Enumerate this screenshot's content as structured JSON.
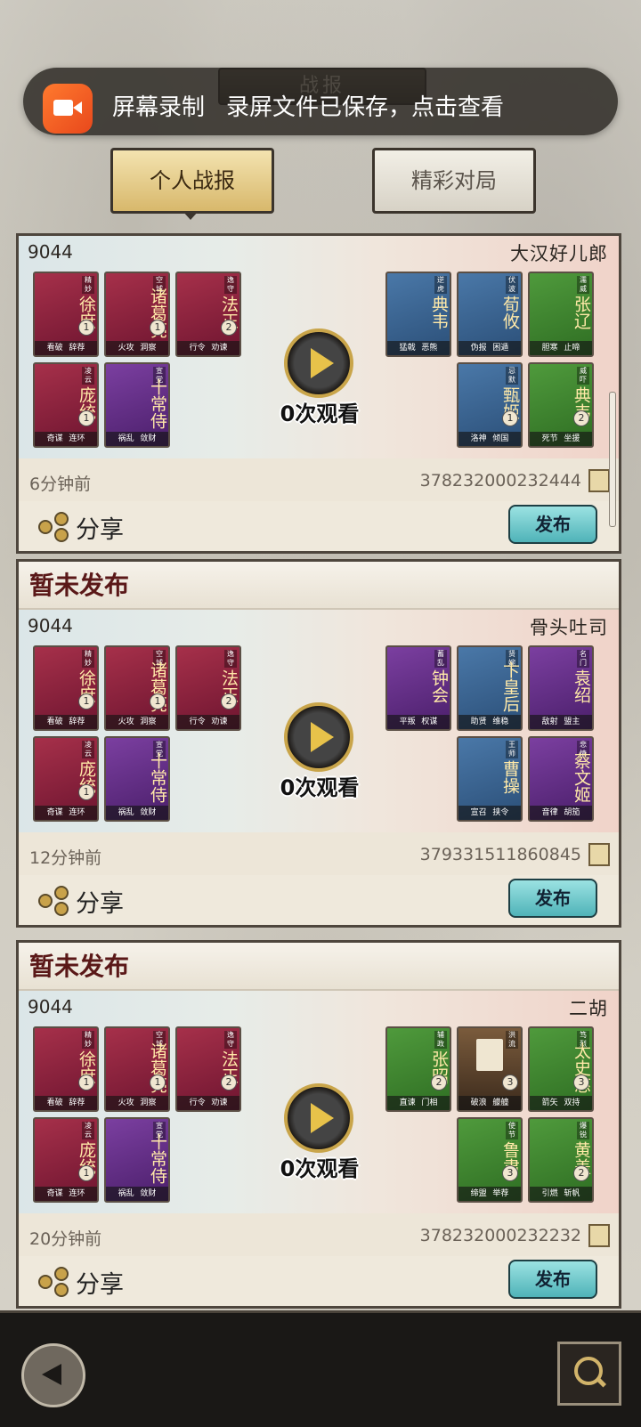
{
  "header": {
    "title": "战报"
  },
  "notification": {
    "app": "屏幕录制",
    "message": "录屏文件已保存，点击查看"
  },
  "tabs": [
    {
      "label": "个人战报",
      "active": true
    },
    {
      "label": "精彩对局",
      "active": false
    }
  ],
  "battles": [
    {
      "status": "",
      "score": "9044",
      "opponent": "大汉好儿郎",
      "views": "0次观看",
      "time": "6分钟前",
      "record_id": "378232000232444",
      "share_label": "分享",
      "publish_label": "发布",
      "left_heroes": [
        {
          "name": "徐庶",
          "tag": "精妙",
          "level": "1",
          "skills": "看破 辞荐",
          "color": "red"
        },
        {
          "name": "诸葛亮",
          "tag": "空城",
          "level": "1",
          "skills": "火攻 洞察",
          "color": "red"
        },
        {
          "name": "法正",
          "tag": "逸守",
          "level": "2",
          "skills": "行令 劝谏",
          "color": "red"
        },
        {
          "name": "庞统",
          "tag": "凌云",
          "level": "1",
          "skills": "奇谋 连环",
          "color": "red"
        },
        {
          "name": "十常侍",
          "tag": "宣党",
          "level": "",
          "skills": "祸乱 敛财",
          "color": "purple"
        }
      ],
      "right_heroes": [
        {
          "name": "典韦",
          "tag": "逆虎",
          "level": "",
          "skills": "猛戟 恶熊",
          "color": "blue"
        },
        {
          "name": "荀攸",
          "tag": "伏波",
          "level": "",
          "skills": "伪报 困遁",
          "color": "blue"
        },
        {
          "name": "张辽",
          "tag": "濡威",
          "level": "",
          "skills": "胆寒 止啼",
          "color": "green"
        },
        {
          "name": "甄姬",
          "tag": "忌默",
          "level": "1",
          "skills": "洛神 倾国",
          "color": "blue"
        },
        {
          "name": "典韦",
          "tag": "威吓",
          "level": "2",
          "skills": "死节 坐援",
          "color": "green"
        }
      ]
    },
    {
      "status": "暂未发布",
      "score": "9044",
      "opponent": "骨头吐司",
      "views": "0次观看",
      "time": "12分钟前",
      "record_id": "379331511860845",
      "share_label": "分享",
      "publish_label": "发布",
      "left_heroes": [
        {
          "name": "徐庶",
          "tag": "精妙",
          "level": "1",
          "skills": "看破 辞荐",
          "color": "red"
        },
        {
          "name": "诸葛亮",
          "tag": "空城",
          "level": "1",
          "skills": "火攻 洞察",
          "color": "red"
        },
        {
          "name": "法正",
          "tag": "逸守",
          "level": "2",
          "skills": "行令 劝谏",
          "color": "red"
        },
        {
          "name": "庞统",
          "tag": "凌云",
          "level": "1",
          "skills": "奇谋 连环",
          "color": "red"
        },
        {
          "name": "十常侍",
          "tag": "宣党",
          "level": "",
          "skills": "祸乱 敛财",
          "color": "purple"
        }
      ],
      "right_heroes": [
        {
          "name": "钟会",
          "tag": "蓄乱",
          "level": "",
          "skills": "平叛 权谋",
          "color": "purple"
        },
        {
          "name": "卞皇后",
          "tag": "贤婉",
          "level": "",
          "skills": "助贤 维稳",
          "color": "blue"
        },
        {
          "name": "袁绍",
          "tag": "名门",
          "level": "",
          "skills": "敌射 盟主",
          "color": "purple"
        },
        {
          "name": "曹操",
          "tag": "王师",
          "level": "",
          "skills": "宣召 挟令",
          "color": "blue"
        },
        {
          "name": "蔡文姬",
          "tag": "悲情",
          "level": "",
          "skills": "音律 胡笳",
          "color": "purple"
        }
      ]
    },
    {
      "status": "暂未发布",
      "score": "9044",
      "opponent": "二胡",
      "views": "0次观看",
      "time": "20分钟前",
      "record_id": "378232000232232",
      "share_label": "分享",
      "publish_label": "发布",
      "left_heroes": [
        {
          "name": "徐庶",
          "tag": "精妙",
          "level": "1",
          "skills": "看破 辞荐",
          "color": "red"
        },
        {
          "name": "诸葛亮",
          "tag": "空城",
          "level": "1",
          "skills": "火攻 洞察",
          "color": "red"
        },
        {
          "name": "法正",
          "tag": "逸守",
          "level": "2",
          "skills": "行令 劝谏",
          "color": "red"
        },
        {
          "name": "庞统",
          "tag": "凌云",
          "level": "1",
          "skills": "奇谋 连环",
          "color": "red"
        },
        {
          "name": "十常侍",
          "tag": "宣党",
          "level": "",
          "skills": "祸乱 敛财",
          "color": "purple"
        }
      ],
      "right_heroes": [
        {
          "name": "张昭",
          "tag": "辅政",
          "level": "2",
          "skills": "直谏 门相",
          "color": "green"
        },
        {
          "name": "",
          "tag": "洪流",
          "level": "3",
          "skills": "破浪 艨艟",
          "color": "ship"
        },
        {
          "name": "太史慈",
          "tag": "笃烈",
          "level": "3",
          "skills": "箭矢 双持",
          "color": "green"
        },
        {
          "name": "鲁肃",
          "tag": "使节",
          "level": "3",
          "skills": "缔盟 举荐",
          "color": "green"
        },
        {
          "name": "黄盖",
          "tag": "爆锐",
          "level": "2",
          "skills": "引燃 斩帆",
          "color": "green"
        }
      ]
    }
  ]
}
